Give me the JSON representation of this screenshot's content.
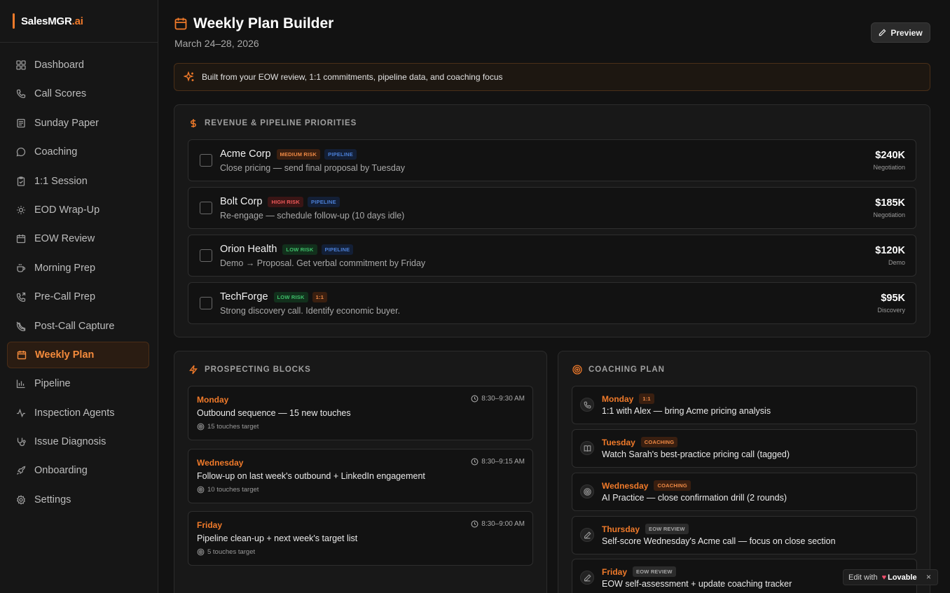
{
  "brand": {
    "name": "SalesMGR",
    "suffix": ".ai"
  },
  "sidebar": {
    "items": [
      {
        "label": "Dashboard",
        "icon": "grid-icon"
      },
      {
        "label": "Call Scores",
        "icon": "phone-icon"
      },
      {
        "label": "Sunday Paper",
        "icon": "newspaper-icon"
      },
      {
        "label": "Coaching",
        "icon": "chat-icon"
      },
      {
        "label": "1:1 Session",
        "icon": "clipboard-icon"
      },
      {
        "label": "EOD Wrap-Up",
        "icon": "sun-icon"
      },
      {
        "label": "EOW Review",
        "icon": "calendar-icon"
      },
      {
        "label": "Morning Prep",
        "icon": "coffee-icon"
      },
      {
        "label": "Pre-Call Prep",
        "icon": "phone-forward-icon"
      },
      {
        "label": "Post-Call Capture",
        "icon": "phone-off-icon"
      },
      {
        "label": "Weekly Plan",
        "icon": "calendar-icon",
        "active": true
      },
      {
        "label": "Pipeline",
        "icon": "bar-chart-icon"
      },
      {
        "label": "Inspection Agents",
        "icon": "activity-icon"
      },
      {
        "label": "Issue Diagnosis",
        "icon": "stethoscope-icon"
      },
      {
        "label": "Onboarding",
        "icon": "rocket-icon"
      },
      {
        "label": "Settings",
        "icon": "gear-icon"
      }
    ]
  },
  "header": {
    "title": "Weekly Plan Builder",
    "date": "March 24–28, 2026",
    "preview_label": "Preview"
  },
  "banner": {
    "text": "Built from your EOW review, 1:1 commitments, pipeline data, and coaching focus"
  },
  "revenue": {
    "heading": "REVENUE & PIPELINE PRIORITIES",
    "deals": [
      {
        "name": "Acme Corp",
        "risk": "MEDIUM RISK",
        "tag": "PIPELINE",
        "desc": "Close pricing — send final proposal by Tuesday",
        "amount": "$240K",
        "stage": "Negotiation"
      },
      {
        "name": "Bolt Corp",
        "risk": "HIGH RISK",
        "tag": "PIPELINE",
        "desc": "Re-engage — schedule follow-up (10 days idle)",
        "amount": "$185K",
        "stage": "Negotiation"
      },
      {
        "name": "Orion Health",
        "risk": "LOW RISK",
        "tag": "PIPELINE",
        "desc": "Demo → Proposal. Get verbal commitment by Friday",
        "amount": "$120K",
        "stage": "Demo"
      },
      {
        "name": "TechForge",
        "risk": "LOW RISK",
        "tag": "1:1",
        "desc": "Strong discovery call. Identify economic buyer.",
        "amount": "$95K",
        "stage": "Discovery"
      }
    ]
  },
  "prospecting": {
    "heading": "PROSPECTING BLOCKS",
    "blocks": [
      {
        "day": "Monday",
        "time": "8:30–9:30 AM",
        "task": "Outbound sequence — 15 new touches",
        "target": "15 touches target"
      },
      {
        "day": "Wednesday",
        "time": "8:30–9:15 AM",
        "task": "Follow-up on last week's outbound + LinkedIn engagement",
        "target": "10 touches target"
      },
      {
        "day": "Friday",
        "time": "8:30–9:00 AM",
        "task": "Pipeline clean-up + next week's target list",
        "target": "5 touches target"
      }
    ]
  },
  "coaching": {
    "heading": "COACHING PLAN",
    "blocks": [
      {
        "day": "Monday",
        "tag": "1:1",
        "task": "1:1 with Alex — bring Acme pricing analysis",
        "icon": "phone-icon"
      },
      {
        "day": "Tuesday",
        "tag": "COACHING",
        "task": "Watch Sarah's best-practice pricing call (tagged)",
        "icon": "book-icon"
      },
      {
        "day": "Wednesday",
        "tag": "COACHING",
        "task": "AI Practice — close confirmation drill (2 rounds)",
        "icon": "target-icon"
      },
      {
        "day": "Thursday",
        "tag": "EOW REVIEW",
        "task": "Self-score Wednesday's Acme call — focus on close section",
        "icon": "pen-icon"
      },
      {
        "day": "Friday",
        "tag": "EOW REVIEW",
        "task": "EOW self-assessment + update coaching tracker",
        "icon": "pen-icon"
      }
    ]
  },
  "lovable": {
    "prefix": "Edit with",
    "brand": "Lovable",
    "close": "×"
  },
  "colors": {
    "accent": "#f07a2a",
    "background": "#121212",
    "risk_high": "#ef5a5a",
    "risk_low": "#3fbf6a",
    "pipeline": "#4b7fd6"
  }
}
